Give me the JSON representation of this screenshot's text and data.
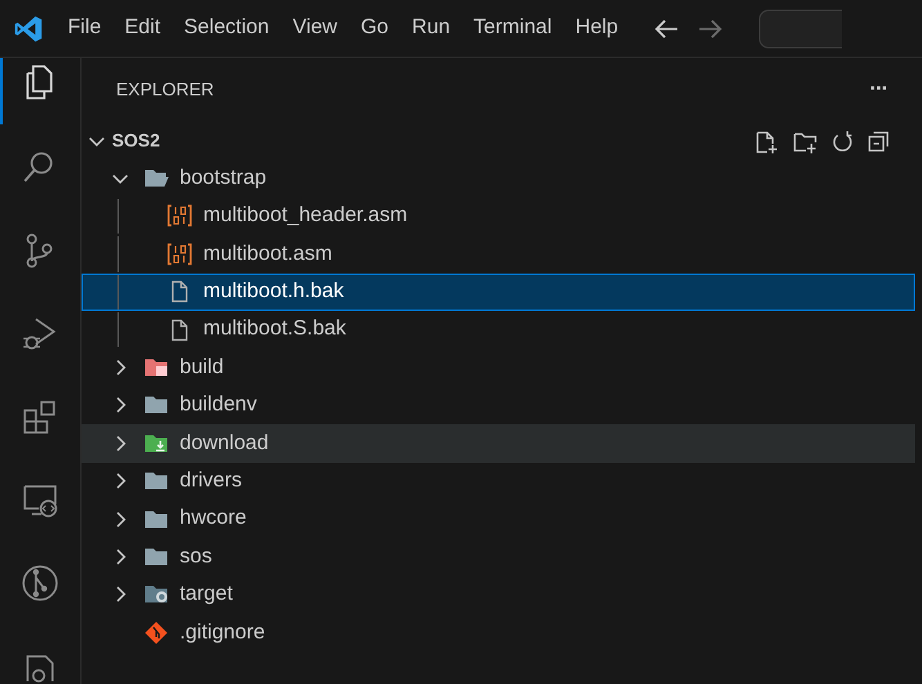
{
  "menu": [
    "File",
    "Edit",
    "Selection",
    "View",
    "Go",
    "Run",
    "Terminal",
    "Help"
  ],
  "navigation": {
    "back_disabled": false,
    "forward_disabled": true
  },
  "activity_bar": [
    {
      "kind": "explorer",
      "selected": true
    },
    {
      "kind": "search",
      "selected": false
    },
    {
      "kind": "source-control",
      "selected": false
    },
    {
      "kind": "run-debug",
      "selected": false
    },
    {
      "kind": "extensions",
      "selected": false
    },
    {
      "kind": "remote",
      "selected": false
    },
    {
      "kind": "graph",
      "selected": false
    },
    {
      "kind": "partial",
      "selected": false
    }
  ],
  "sidebar": {
    "title": "EXPLORER",
    "more": "···"
  },
  "tree": [
    {
      "label": "SOS2",
      "kind": "root",
      "expanded": true,
      "selected": false,
      "hovered": false,
      "children": [
        {
          "label": "bootstrap",
          "kind": "folder",
          "expanded": true,
          "selected": false,
          "hovered": false,
          "children": [
            {
              "label": "multiboot_header.asm",
              "kind": "asm-file",
              "selected": false,
              "hovered": false
            },
            {
              "label": "multiboot.asm",
              "kind": "asm-file",
              "selected": false,
              "hovered": false
            },
            {
              "label": "multiboot.h.bak",
              "kind": "text-file",
              "selected": true,
              "hovered": false
            },
            {
              "label": "multiboot.S.bak",
              "kind": "text-file",
              "selected": false,
              "hovered": false
            }
          ]
        },
        {
          "label": "build",
          "kind": "build-folder",
          "expanded": false,
          "selected": false,
          "hovered": false
        },
        {
          "label": "buildenv",
          "kind": "folder",
          "expanded": false,
          "selected": false,
          "hovered": false
        },
        {
          "label": "download",
          "kind": "download-folder",
          "expanded": false,
          "selected": false,
          "hovered": true
        },
        {
          "label": "drivers",
          "kind": "folder",
          "expanded": false,
          "selected": false,
          "hovered": false
        },
        {
          "label": "hwcore",
          "kind": "folder",
          "expanded": false,
          "selected": false,
          "hovered": false
        },
        {
          "label": "sos",
          "kind": "folder",
          "expanded": false,
          "selected": false,
          "hovered": false
        },
        {
          "label": "target",
          "kind": "target-folder",
          "expanded": false,
          "selected": false,
          "hovered": false
        },
        {
          "label": ".gitignore",
          "kind": "git-file",
          "selected": false,
          "hovered": false
        }
      ]
    }
  ]
}
